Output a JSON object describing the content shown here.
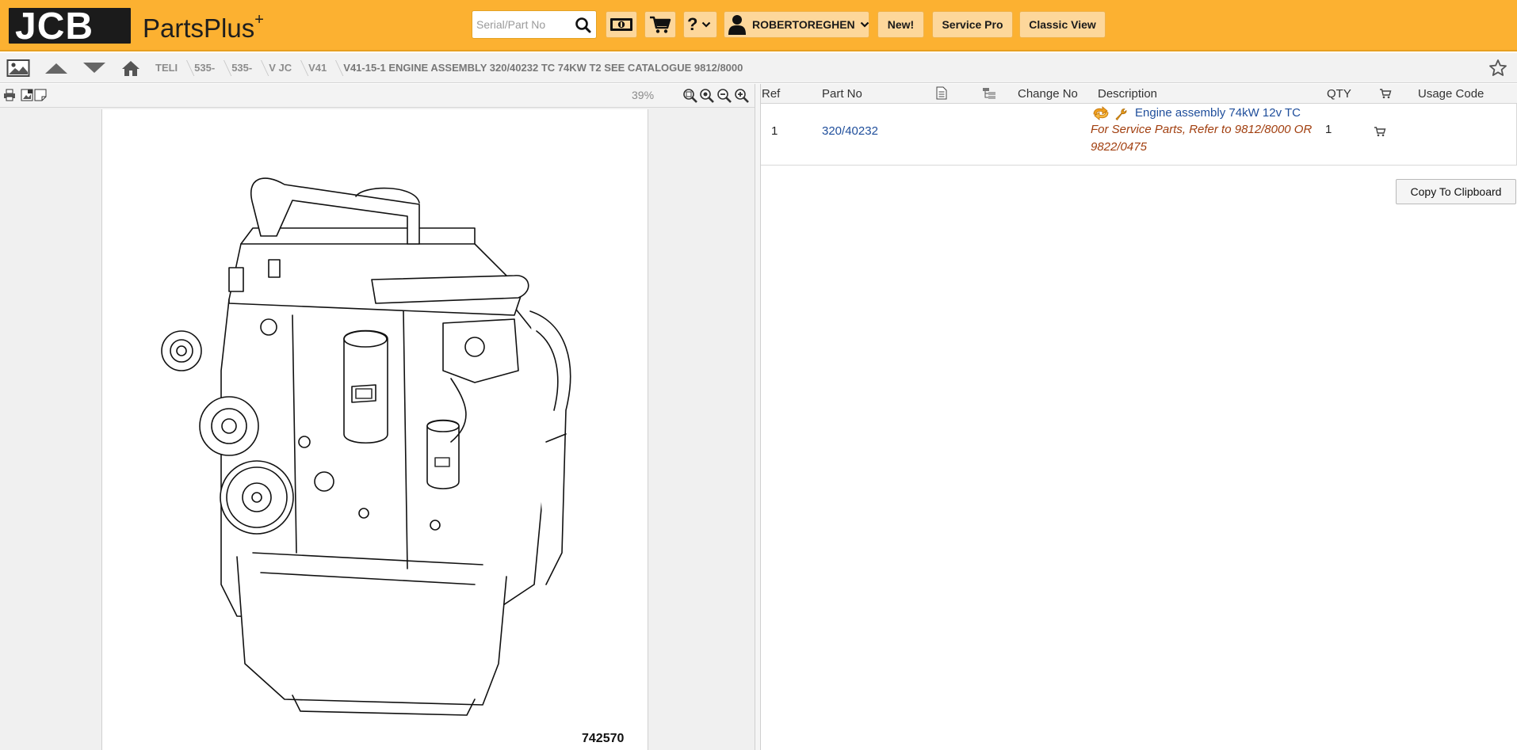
{
  "header": {
    "logo_text": "JCB",
    "brand_name": "PartsPlus",
    "brand_suffix": "+",
    "search": {
      "placeholder": "Serial/Part No",
      "value": ""
    },
    "icons": [
      "search-icon",
      "currency-icon",
      "cart-icon",
      "help-icon",
      "chevron-down-icon",
      "user-icon"
    ],
    "help_label": "?",
    "user_name": "ROBERTOREGHEN",
    "buttons": {
      "new": "New!",
      "service_pro": "Service Pro",
      "classic_view": "Classic View"
    },
    "accent_color": "#fcb131"
  },
  "breadcrumb": {
    "icons": [
      "image-icon",
      "arrow-up-icon",
      "arrow-down-icon",
      "home-icon",
      "star-icon"
    ],
    "items": [
      "TELI",
      "535-",
      "535-",
      "V JC",
      "V41",
      "V41-15-1 ENGINE ASSEMBLY 320/40232 TC 74KW T2 SEE CATALOGUE 9812/8000"
    ]
  },
  "viewer": {
    "zoom": "39%",
    "tool_icons": [
      "print-icon",
      "save-image-icon",
      "note-icon"
    ],
    "zoom_icons": [
      "zoom-fit-icon",
      "zoom-reset-icon",
      "zoom-out-icon",
      "zoom-in-icon"
    ],
    "drawing_number": "742570"
  },
  "parts_table": {
    "columns": [
      "Ref",
      "Part No",
      "",
      "",
      "Change No",
      "Description",
      "QTY",
      "",
      "Usage Code"
    ],
    "header_icons": [
      "document-icon",
      "hierarchy-icon",
      "cart-icon"
    ],
    "rows": [
      {
        "ref": "1",
        "part_no": "320/40232",
        "change_no": "",
        "description": "Engine assembly 74kW 12v TC",
        "note": "For Service Parts, Refer to 9812/8000 OR 9822/0475",
        "qty": "1",
        "usage_code": "",
        "icons": [
          "exchange-icon",
          "wrench-icon",
          "add-to-cart-icon"
        ]
      }
    ],
    "copy_button": "Copy To Clipboard"
  }
}
